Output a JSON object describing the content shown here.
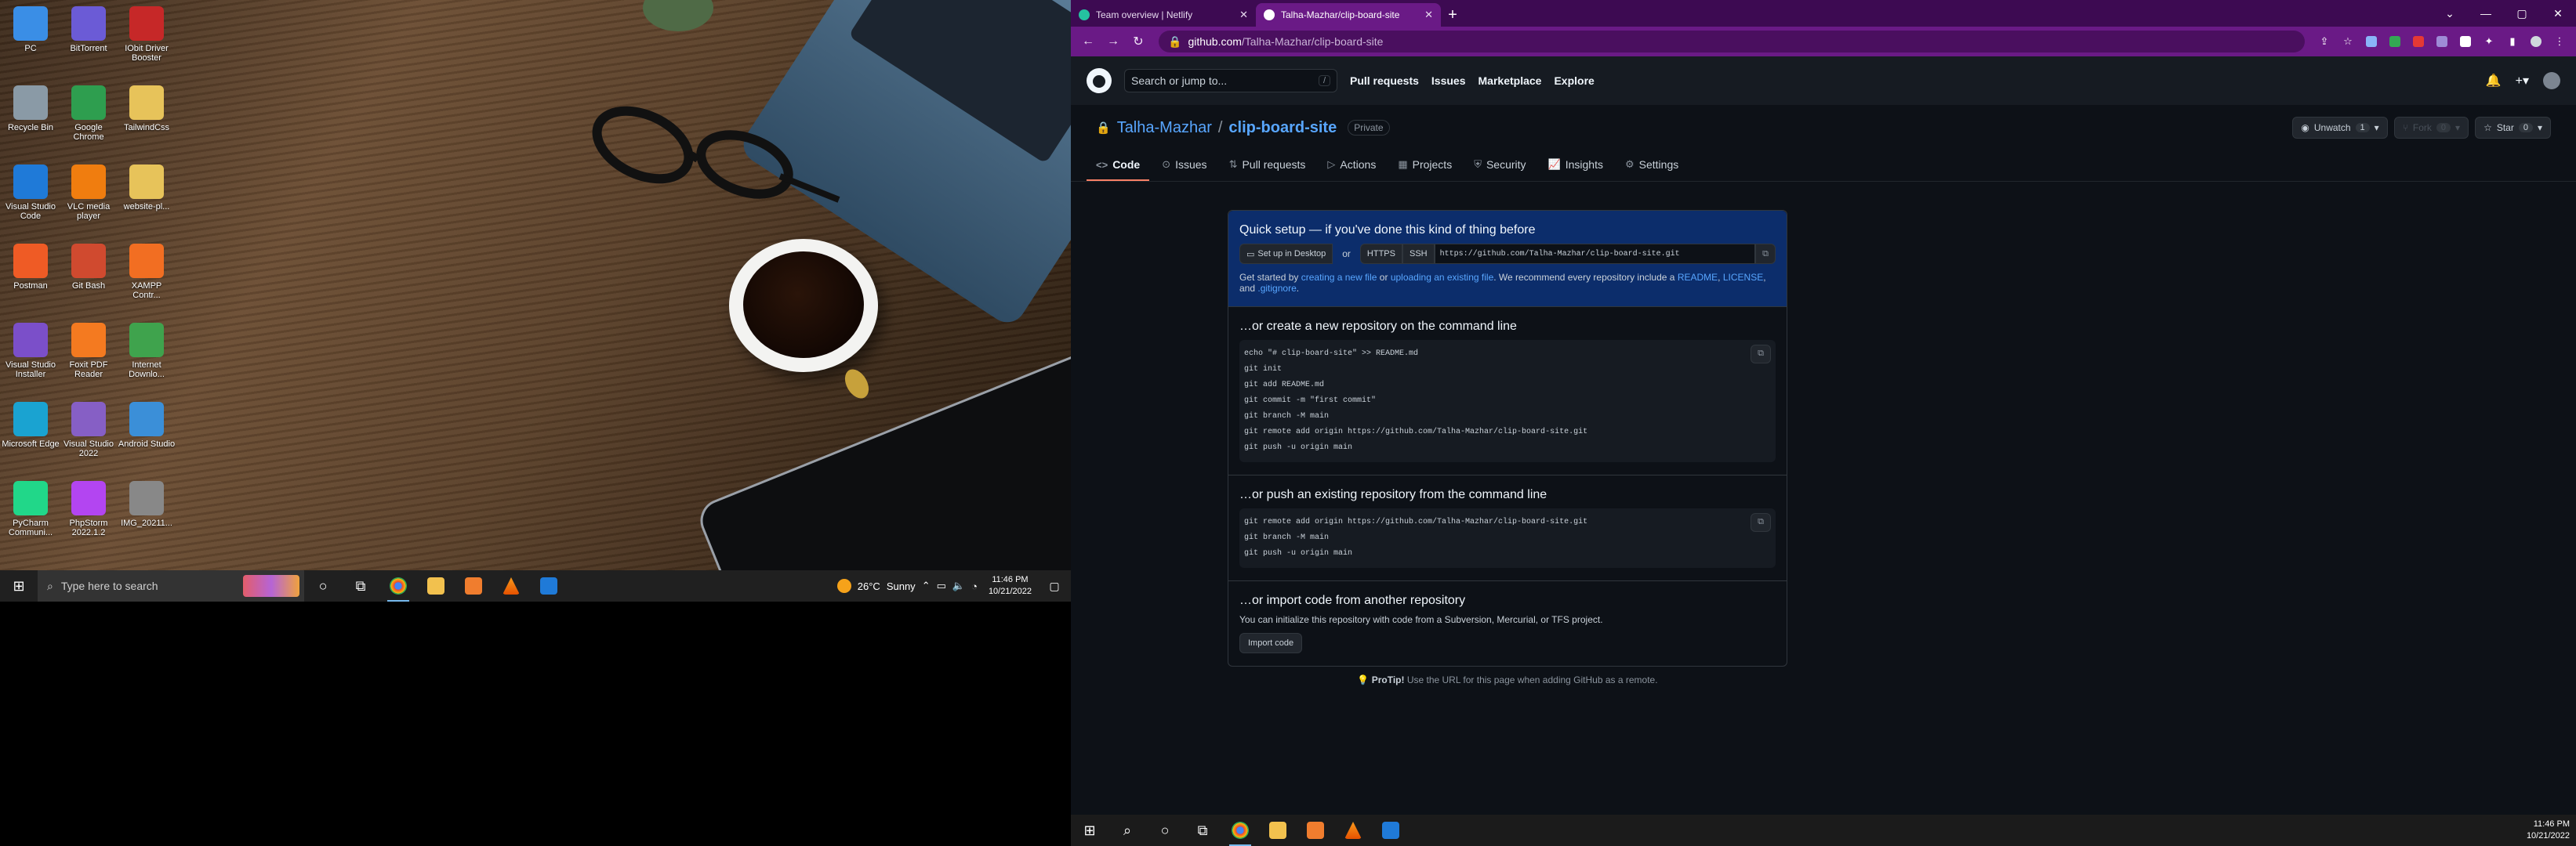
{
  "left_desktop": {
    "icons": [
      {
        "label": "PC",
        "icon": "pc-icon",
        "color": "#3a8ee6"
      },
      {
        "label": "BitTorrent",
        "icon": "bittorrent-icon",
        "color": "#6b5bd6"
      },
      {
        "label": "IObit Driver Booster",
        "icon": "driver-booster-icon",
        "color": "#c62828"
      },
      {
        "label": "Recycle Bin",
        "icon": "recycle-bin-icon",
        "color": "#8a9aa6"
      },
      {
        "label": "Google Chrome",
        "icon": "chrome-icon",
        "color": "#2e9e4f"
      },
      {
        "label": "TailwindCss",
        "icon": "folder-icon",
        "color": "#e7c35a"
      },
      {
        "label": "Visual Studio Code",
        "icon": "vscode-icon",
        "color": "#1f7ad8"
      },
      {
        "label": "VLC media player",
        "icon": "vlc-icon",
        "color": "#f07d0f"
      },
      {
        "label": "website-pl...",
        "icon": "folder-icon",
        "color": "#e7c35a"
      },
      {
        "label": "Postman",
        "icon": "postman-icon",
        "color": "#ef5b25"
      },
      {
        "label": "Git Bash",
        "icon": "git-bash-icon",
        "color": "#d04a2f"
      },
      {
        "label": "XAMPP Contr...",
        "icon": "xampp-icon",
        "color": "#f26e22"
      },
      {
        "label": "Visual Studio Installer",
        "icon": "vs-installer-icon",
        "color": "#7b4fc9"
      },
      {
        "label": "Foxit PDF Reader",
        "icon": "foxit-icon",
        "color": "#f47a20"
      },
      {
        "label": "Internet Downlo...",
        "icon": "idm-icon",
        "color": "#3fa34d"
      },
      {
        "label": "Microsoft Edge",
        "icon": "edge-icon",
        "color": "#1aa3d1"
      },
      {
        "label": "Visual Studio 2022",
        "icon": "visual-studio-icon",
        "color": "#865fc5"
      },
      {
        "label": "Android Studio",
        "icon": "android-studio-icon",
        "color": "#3b8fd8"
      },
      {
        "label": "PyCharm Communi...",
        "icon": "pycharm-icon",
        "color": "#21d789"
      },
      {
        "label": "PhpStorm 2022.1.2",
        "icon": "phpstorm-icon",
        "color": "#b345f1"
      },
      {
        "label": "IMG_20211...",
        "icon": "image-file-icon",
        "color": "#888888"
      }
    ],
    "taskbar": {
      "search_placeholder": "Type here to search",
      "weather_temp": "26°C",
      "weather_text": "Sunny",
      "clock_time": "11:46 PM",
      "clock_date": "10/21/2022"
    }
  },
  "browser": {
    "tabs": [
      {
        "title": "Team overview | Netlify",
        "favicon_color": "#25c2a0",
        "active": false
      },
      {
        "title": "Talha-Mazhar/clip-board-site",
        "favicon_color": "#ffffff",
        "active": true
      }
    ],
    "address": {
      "host": "github.com",
      "path": "/Talha-Mazhar/clip-board-site"
    }
  },
  "github": {
    "search_placeholder": "Search or jump to...",
    "search_shortcut": "/",
    "nav": [
      "Pull requests",
      "Issues",
      "Marketplace",
      "Explore"
    ],
    "repo": {
      "owner": "Talha-Mazhar",
      "separator": "/",
      "name": "clip-board-site",
      "visibility": "Private",
      "unwatch_label": "Unwatch",
      "unwatch_count": "1",
      "fork_label": "Fork",
      "fork_count": "0",
      "star_label": "Star",
      "star_count": "0"
    },
    "tabs": [
      {
        "label": "Code",
        "icon": "code-icon"
      },
      {
        "label": "Issues",
        "icon": "issues-icon"
      },
      {
        "label": "Pull requests",
        "icon": "pull-request-icon"
      },
      {
        "label": "Actions",
        "icon": "actions-icon"
      },
      {
        "label": "Projects",
        "icon": "projects-icon"
      },
      {
        "label": "Security",
        "icon": "security-icon"
      },
      {
        "label": "Insights",
        "icon": "insights-icon"
      },
      {
        "label": "Settings",
        "icon": "settings-icon"
      }
    ],
    "quick_setup": {
      "title": "Quick setup — if you've done this kind of thing before",
      "desktop_button": "Set up in Desktop",
      "or": "or",
      "https": "HTTPS",
      "ssh": "SSH",
      "clone_url": "https://github.com/Talha-Mazhar/clip-board-site.git",
      "intro_1": "Get started by",
      "link_new_file": "creating a new file",
      "intro_2": "or",
      "link_upload": "uploading an existing file",
      "intro_3": ". We recommend every repository include a",
      "link_readme": "README",
      "intro_4": ",",
      "link_license": "LICENSE",
      "intro_5": ", and",
      "link_gitignore": ".gitignore",
      "intro_6": "."
    },
    "create_section": {
      "title": "…or create a new repository on the command line",
      "lines": [
        "echo \"# clip-board-site\" >> README.md",
        "git init",
        "git add README.md",
        "git commit -m \"first commit\"",
        "git branch -M main",
        "git remote add origin https://github.com/Talha-Mazhar/clip-board-site.git",
        "git push -u origin main"
      ]
    },
    "push_section": {
      "title": "…or push an existing repository from the command line",
      "lines": [
        "git remote add origin https://github.com/Talha-Mazhar/clip-board-site.git",
        "git branch -M main",
        "git push -u origin main"
      ]
    },
    "import_section": {
      "title": "…or import code from another repository",
      "description": "You can initialize this repository with code from a Subversion, Mercurial, or TFS project.",
      "button": "Import code"
    },
    "protip": {
      "label": "ProTip!",
      "text": "Use the URL for this page when adding GitHub as a remote."
    }
  },
  "right_taskbar": {
    "clock_time": "11:46 PM",
    "clock_date": "10/21/2022"
  }
}
